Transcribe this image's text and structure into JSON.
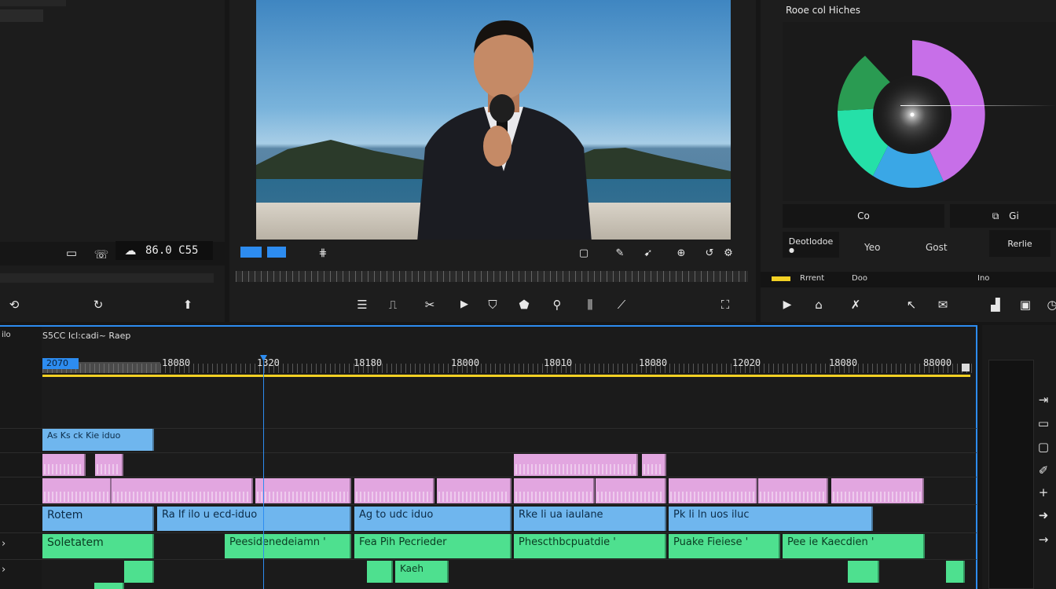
{
  "left_panel": {
    "top_label": "",
    "timecode": "86.0 C55",
    "icons": [
      "audio-icon",
      "phone-icon",
      "cloud-icon"
    ]
  },
  "preview": {
    "badge1": "",
    "badge2": "",
    "toolbar_icons": [
      "list-icon",
      "trim-icon",
      "split-icon",
      "play-icon",
      "shield-icon",
      "mask-icon",
      "search-icon",
      "bars-icon",
      "pen-icon",
      "crop-icon"
    ]
  },
  "color_panel": {
    "title": "Rooe col Hiches",
    "btn_co": "Co",
    "btn_co2": "Gi",
    "btn_left": "Deotlodoe",
    "btn_yes": "Yeo",
    "btn_goat": "Gost",
    "btn_right": "Rerlie",
    "sub_label1": "Rrrent",
    "sub_label2": "Doo",
    "sub_label3": "Ino"
  },
  "timeline": {
    "header_left": "ilo",
    "header_title": "S5CC Icl:cadi~ Raep",
    "playhead_time": "2070",
    "ruler": [
      "18080",
      "1320",
      "18180",
      "18000",
      "18010",
      "18080",
      "12020",
      "18080",
      "88000"
    ],
    "tracks": {
      "blue_top": "As Ks ck Kie iduo",
      "pink_a": "",
      "pink_b": "",
      "pink_c": "",
      "blue_row": [
        "Rotem",
        "Ra If ilo u ecd-iduo",
        "Ag to udc iduo",
        "Rke li ua iaulane",
        "Pk li ln uos iluc"
      ],
      "green_row": [
        "Soletatem",
        "Peesidenedeiamn '",
        "Fea Pih Pecrieder",
        "Phescthbcpuatdie '",
        "Puake Fieiese '",
        "Pee ie Kaecdien '"
      ],
      "green_small": [
        "",
        "Kaeh"
      ]
    }
  },
  "colors": {
    "accent_blue": "#2d8cf0",
    "yellow": "#f2d024",
    "clip_blue": "#6fb6ee",
    "clip_pink": "#e2a6e0",
    "clip_green": "#4ee08f"
  }
}
